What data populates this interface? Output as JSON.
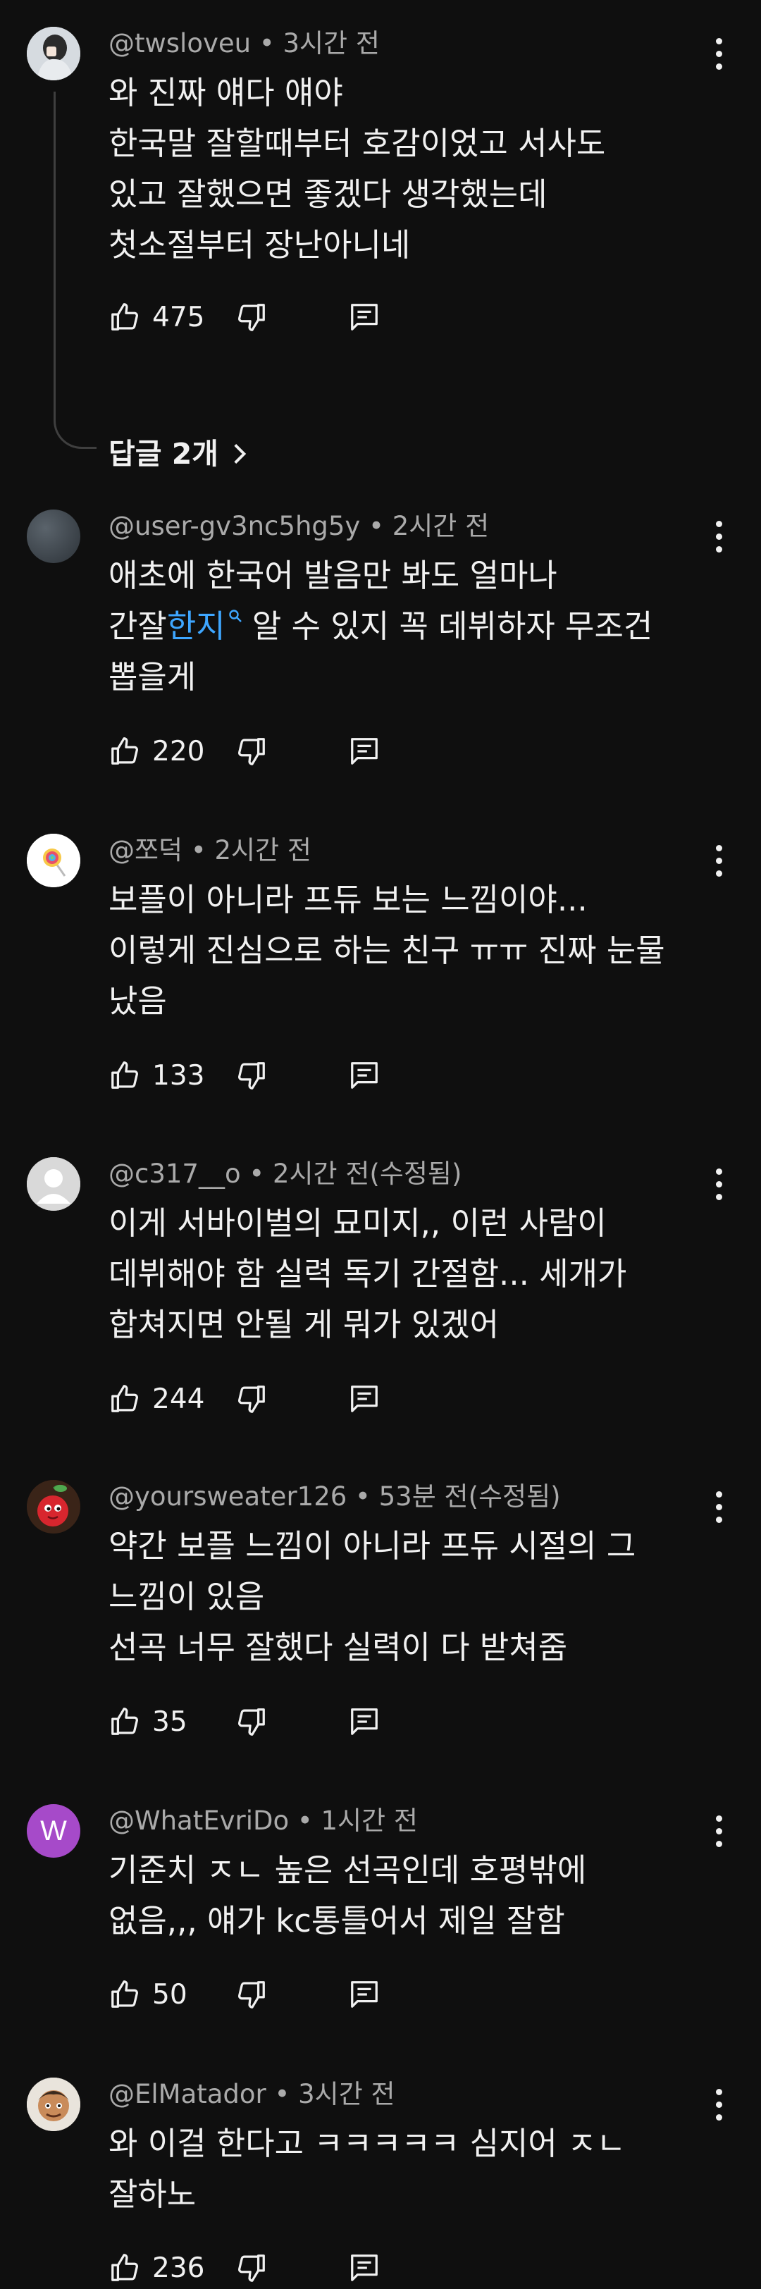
{
  "comments": [
    {
      "user": "@twsloveu",
      "time": "3시간 전",
      "lines": [
        "와 진짜 얘다 얘야",
        "한국말 잘할때부터 호감이었고 서사도",
        "있고 잘했으면 좋겠다 생각했는데",
        "첫소절부터 장난아니네"
      ],
      "likes": "475",
      "avatar": "photo-dark-person-icon",
      "replies_label": "답글 2개"
    },
    {
      "user": "@user-gv3nc5hg5y",
      "time": "2시간 전",
      "line1": "애초에 한국어 발음만 봐도 얼마나",
      "line2_before": "간잘",
      "line2_hashtag": "한지",
      "line2_after": " 알 수 있지 꼭 데뷔하자 무조건",
      "line3": "뽑을게",
      "likes": "220",
      "avatar": "gray-blur-avatar-icon"
    },
    {
      "user": "@쪼덕",
      "time": "2시간 전",
      "lines": [
        "보플이 아니라 프듀 보는 느낌이야...",
        "이렇게 진심으로 하는 친구 ㅠㅠ 진짜 눈물",
        "났음"
      ],
      "likes": "133",
      "avatar": "lollipop-avatar-icon"
    },
    {
      "user": "@c317__o",
      "time": "2시간 전(수정됨)",
      "lines": [
        "이게 서바이벌의 묘미지,, 이런 사람이",
        "데뷔해야 함 실력 독기 간절함... 세개가",
        "합쳐지면 안될 게 뭐가 있겠어"
      ],
      "likes": "244",
      "avatar": "default-person-avatar-icon"
    },
    {
      "user": "@yoursweater126",
      "time": "53분 전(수정됨)",
      "lines": [
        "약간 보플 느낌이 아니라 프듀 시절의 그",
        "느낌이 있음",
        "선곡 너무 잘했다 실력이 다 받쳐줌"
      ],
      "likes": "35",
      "avatar": "cherry-avatar-icon"
    },
    {
      "user": "@WhatEvriDo",
      "time": "1시간 전",
      "lines": [
        "기준치 ㅈㄴ 높은 선곡인데 호평밖에",
        "없음,,, 얘가 kc통틀어서 제일 잘함"
      ],
      "likes": "50",
      "avatar": "letter-avatar-icon",
      "avatar_letter": "W"
    },
    {
      "user": "@ElMatador",
      "time": "3시간 전",
      "lines": [
        "와 이걸 한다고 ㅋㅋㅋㅋㅋ 심지어 ㅈㄴ",
        "잘하노"
      ],
      "likes": "236",
      "avatar": "cartoon-face-avatar-icon"
    }
  ],
  "separator": " • ",
  "icons": [
    "like-icon",
    "dislike-icon",
    "reply-icon",
    "more-vert-icon",
    "chevron-right-icon",
    "search-hashtag-icon"
  ],
  "colors": {
    "background": "#0f0f0f",
    "text": "#f1f1f1",
    "meta": "#aaaaaa",
    "link": "#3ea6ff",
    "w_avatar": "#a64ac9"
  }
}
